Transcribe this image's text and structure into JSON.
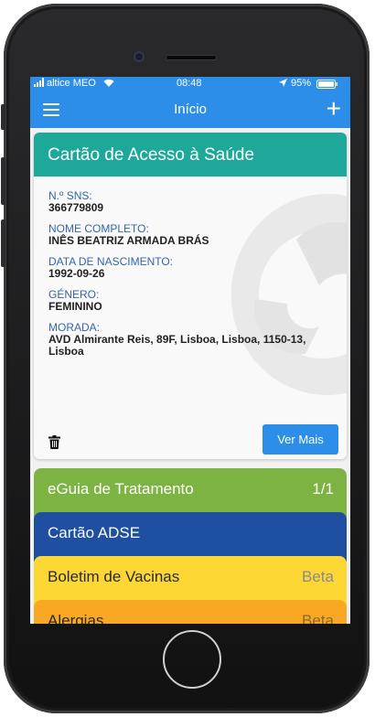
{
  "status_bar": {
    "carrier": "altice MEO",
    "time": "08:48",
    "battery": "95%"
  },
  "nav": {
    "title": "Início"
  },
  "card": {
    "title": "Cartão de Acesso à Saúde",
    "fields": [
      {
        "label": "N.º SNS:",
        "value": "366779809"
      },
      {
        "label": "NOME COMPLETO:",
        "value": "INÊS BEATRIZ ARMADA BRÁS"
      },
      {
        "label": "DATA DE NASCIMENTO:",
        "value": "1992-09-26"
      },
      {
        "label": "GÉNERO:",
        "value": "FEMININO"
      },
      {
        "label": "MORADA:",
        "value": "AVD Almirante Reis, 89F, Lisboa, Lisboa, 1150-13, Lisboa"
      }
    ],
    "button": "Ver Mais"
  },
  "stack": [
    {
      "title": "eGuia de Tratamento",
      "right": "1/1"
    },
    {
      "title": "Cartão ADSE",
      "right": ""
    },
    {
      "title": "Boletim de Vacinas",
      "right": "Beta"
    },
    {
      "title": "Alergias",
      "right": "Beta"
    }
  ],
  "colors": {
    "nav_blue": "#2c8ee9",
    "card_teal": "#1ea89a",
    "egui_green": "#7cb342",
    "adse_blue": "#1e4fa1",
    "vacinas_yellow": "#fdd835",
    "alergias_orange": "#f9a825"
  }
}
